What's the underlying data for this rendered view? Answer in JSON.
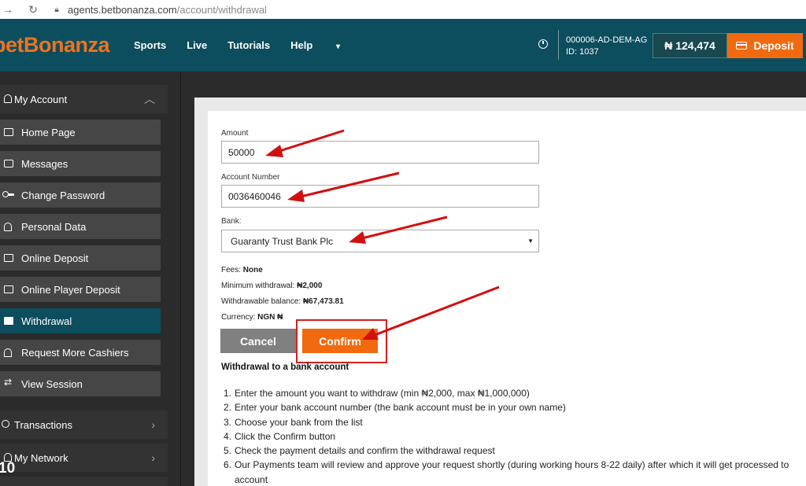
{
  "browser": {
    "back_icon": "arrow-left-icon",
    "reload_icon": "reload-icon",
    "url_host": "agents.betbonanza.com",
    "url_path": "/account/withdrawal"
  },
  "header": {
    "logo": "betBonanza",
    "nav": [
      "Sports",
      "Live",
      "Tutorials",
      "Help"
    ],
    "help_caret": "▾",
    "account_name": "000006-AD-DEM-AG",
    "account_id": "ID: 1037",
    "balance": "₦ 124,474",
    "deposit_label": "Deposit",
    "brand_color": "#f26a0f",
    "header_color": "#0c4d5e"
  },
  "sidebar": {
    "my_account": "My Account",
    "items": [
      {
        "label": "Home Page",
        "icon": "document-icon"
      },
      {
        "label": "Messages",
        "icon": "message-icon"
      },
      {
        "label": "Change Password",
        "icon": "key-icon"
      },
      {
        "label": "Personal Data",
        "icon": "person-icon"
      },
      {
        "label": "Online Deposit",
        "icon": "card-icon"
      },
      {
        "label": "Online Player Deposit",
        "icon": "card-icon"
      },
      {
        "label": "Withdrawal",
        "icon": "withdrawal-icon"
      },
      {
        "label": "Request More Cashiers",
        "icon": "person-icon"
      },
      {
        "label": "View Session",
        "icon": "arrows-icon"
      }
    ],
    "transactions": "Transactions",
    "my_network": "My Network",
    "page_badge": "10"
  },
  "form": {
    "amount_label": "Amount",
    "amount_value": "50000",
    "account_number_label": "Account Number",
    "account_number_value": "0036460046",
    "bank_label": "Bank:",
    "bank_value": "Guaranty Trust Bank Plc",
    "fees_label": "Fees:",
    "fees_value": "None",
    "min_label": "Minimum withdrawal:",
    "min_value": "₦2,000",
    "withdrawable_label": "Withdrawable balance:",
    "withdrawable_value": "₦67,473.81",
    "currency_label": "Currency:",
    "currency_value": "NGN ₦",
    "cancel": "Cancel",
    "confirm": "Confirm"
  },
  "instructions": {
    "title": "Withdrawal to a bank account",
    "steps": [
      "Enter the amount you want to withdraw (min ₦2,000, max ₦1,000,000)",
      "Enter your bank account number (the bank account must be in your own name)",
      "Choose your bank from the list",
      "Click the Confirm button",
      "Check the payment details and confirm the withdrawal request",
      "Our Payments team will review and approve your request shortly (during working hours 8-22 daily) after which it will get processed to",
      "account"
    ],
    "nums": [
      "1.",
      "2.",
      "3.",
      "4.",
      "5.",
      "6."
    ]
  }
}
